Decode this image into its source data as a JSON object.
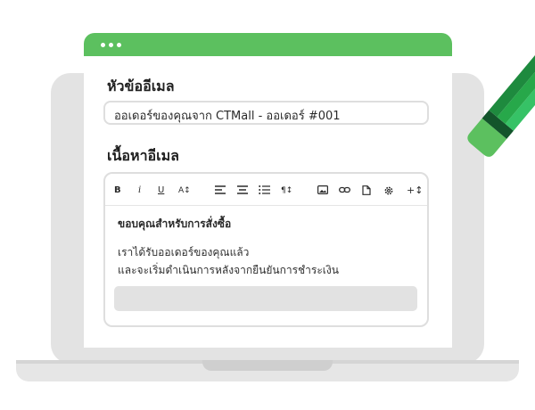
{
  "window": {
    "subject_label": "หัวข้ออีเมล",
    "subject_value": "ออเดอร์ของคุณจาก CTMall - ออเดอร์ #001",
    "content_label": "เนื้อหาอีเมล"
  },
  "toolbar": {
    "bold": "B",
    "italic": "i",
    "underline": "U",
    "font_size": "A↕",
    "paragraph": "¶↕",
    "more": "+↕"
  },
  "email_body": {
    "heading": "ขอบคุณสำหรับการสั่งซื้อ",
    "line1": "เราได้รับออเดอร์ของคุณแล้ว",
    "line2": "และจะเริ่มดำเนินการหลังจากยืนยันการชำระเงิน"
  },
  "colors": {
    "accent_green": "#5cc05f",
    "pencil_dark": "#1e8a3e",
    "pencil_mid": "#27a84a",
    "pencil_tip": "#dff3dc"
  }
}
